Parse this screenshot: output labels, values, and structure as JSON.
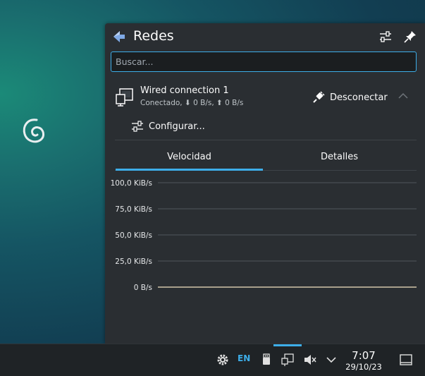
{
  "applet": {
    "title": "Redes",
    "search_placeholder": "Buscar..."
  },
  "connection": {
    "name": "Wired connection 1",
    "status": "Conectado, ⬇ 0 B/s, ⬆ 0 B/s",
    "disconnect_label": "Desconectar",
    "configure_label": "Configurar..."
  },
  "tabs": [
    {
      "label": "Velocidad",
      "active": true
    },
    {
      "label": "Detalles",
      "active": false
    }
  ],
  "chart_data": {
    "type": "line",
    "yticks": [
      "100,0 KiB/s",
      "75,0 KiB/s",
      "50,0 KiB/s",
      "25,0 KiB/s",
      "0 B/s"
    ],
    "ylim": [
      0,
      100
    ],
    "series": [
      {
        "values": [
          0,
          0,
          0,
          0,
          0,
          0,
          0,
          0,
          0,
          0
        ]
      }
    ],
    "grid": true
  },
  "taskbar": {
    "language": "EN",
    "time": "7:07",
    "date": "29/10/23"
  },
  "colors": {
    "accent": "#3daee9",
    "panel": "#2a2e32",
    "taskbar": "#1f2326"
  }
}
